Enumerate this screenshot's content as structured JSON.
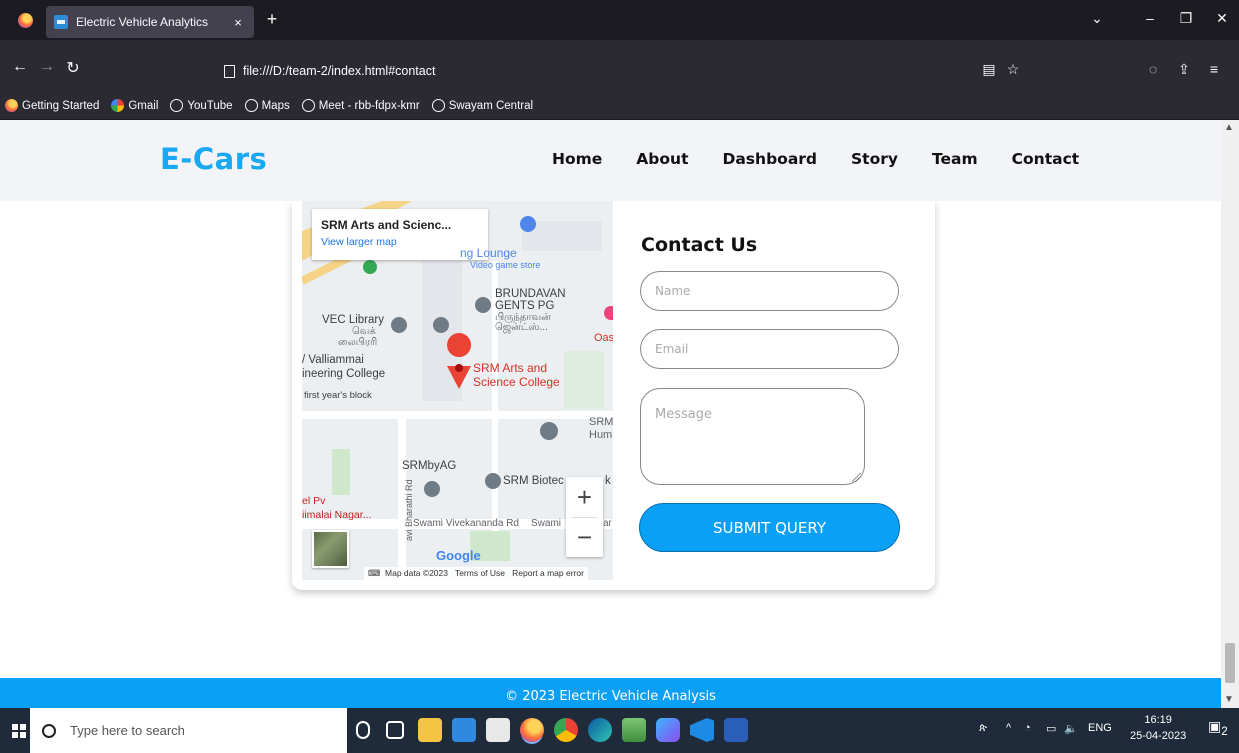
{
  "browser": {
    "tab_title": "Electric Vehicle Analytics",
    "tab_close": "×",
    "new_tab": "+",
    "url": "file:///D:/team-2/index.html#contact",
    "bookmarks": [
      "Getting Started",
      "Gmail",
      "YouTube",
      "Maps",
      "Meet - rbb-fdpx-kmr",
      "Swayam Central"
    ]
  },
  "site": {
    "logo": "E-Cars",
    "nav": [
      "Home",
      "About",
      "Dashboard",
      "Story",
      "Team",
      "Contact"
    ]
  },
  "map": {
    "place_title": "SRM Arts and Scienc...",
    "larger_map_link": "View larger map",
    "labels": {
      "lounge": "ng Lounge",
      "video_store": "Video game store",
      "brundavan": "BRUNDAVAN",
      "gents_pg": "GENTS PG",
      "tamil_1": "பிருந்தாவன்",
      "tamil_2": "ஜென்ட்ஸ்...",
      "vec_library": "VEC Library",
      "vec_tamil_1": "வெக்",
      "vec_tamil_2": "லைபிரரி",
      "oas": "Oas",
      "valliammai_1": "/ Valliammai",
      "valliammai_2": "ineering College",
      "srm_arts_1": "SRM Arts and",
      "srm_arts_2": "Science College",
      "first_year": "first year's block",
      "srm_hum_1": "SRM",
      "srm_hum_2": "Hum",
      "srmbyag": "SRMbyAG",
      "srm_biotech": "SRM Biotec",
      "biotech_k": "k",
      "pv": "el Pv",
      "nagar": "iimalai Nagar...",
      "vivekananda": "Swami Vivekananda Rd",
      "swami": "Swami",
      "ar": "ar",
      "bharathi": "avi Bharathi Rd"
    },
    "zoom_in": "+",
    "zoom_out": "−",
    "google": "Google",
    "map_data": "Map data ©2023",
    "terms": "Terms of Use",
    "report": "Report a map error"
  },
  "contact": {
    "title": "Contact Us",
    "name_placeholder": "Name",
    "email_placeholder": "Email",
    "message_placeholder": "Message",
    "submit_label": "SUBMIT QUERY"
  },
  "footer": {
    "text": "© 2023 Electric Vehicle Analysis"
  },
  "taskbar": {
    "search_placeholder": "Type here to search",
    "language": "ENG",
    "time": "16:19",
    "date": "25-04-2023",
    "notifications": "2"
  },
  "colors": {
    "brand": "#1aa8f4",
    "button": "#0aa0f6",
    "footer": "#0aa0f6"
  }
}
